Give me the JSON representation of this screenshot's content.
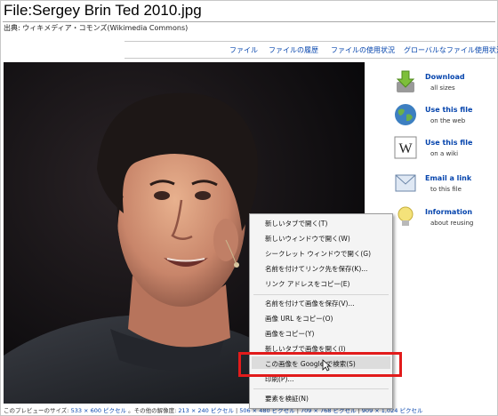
{
  "page": {
    "title": "File:Sergey Brin Ted 2010.jpg",
    "source": "出典: ウィキメディア・コモンズ(Wikimedia Commons)"
  },
  "tabs": [
    {
      "label": "ファイル"
    },
    {
      "label": "ファイルの履歴"
    },
    {
      "label": "ファイルの使用状況"
    },
    {
      "label": "グローバルなファイル使用状況"
    }
  ],
  "sidebar": {
    "items": [
      {
        "title": "Download",
        "sub": "all sizes",
        "icon": "download-icon"
      },
      {
        "title": "Use this file",
        "sub": "on the web",
        "icon": "globe-icon"
      },
      {
        "title": "Use this file",
        "sub": "on a wiki",
        "icon": "wikipedia-icon"
      },
      {
        "title": "Email a link",
        "sub": "to this file",
        "icon": "email-icon"
      },
      {
        "title": "Information",
        "sub": "about reusing",
        "icon": "lightbulb-icon"
      }
    ]
  },
  "context_menu": {
    "items": [
      {
        "label": "新しいタブで開く(T)"
      },
      {
        "label": "新しいウィンドウで開く(W)"
      },
      {
        "label": "シークレット ウィンドウで開く(G)"
      },
      {
        "label": "名前を付けてリンク先を保存(K)..."
      },
      {
        "label": "リンク アドレスをコピー(E)"
      },
      {
        "label": "名前を付けて画像を保存(V)..."
      },
      {
        "label": "画像 URL をコピー(O)"
      },
      {
        "label": "画像をコピー(Y)"
      },
      {
        "label": "新しいタブで画像を開く(I)"
      },
      {
        "label": "この画像を Google で検索(S)"
      },
      {
        "label": "印刷(P)..."
      },
      {
        "label": "要素を検証(N)"
      }
    ],
    "highlighted_index": 9
  },
  "caption": {
    "text": "このプレビューのサイズ:",
    "size_link": "533 × 600 ピクセル",
    "other_text": "。その他の解像度:",
    "res": [
      "213 × 240 ピクセル",
      "506 × 480 ピクセル",
      "709 × 768 ピクセル",
      "909 × 1,024 ピクセル"
    ]
  },
  "colors": {
    "link": "#0645ad",
    "highlight_box": "#e21b1b",
    "photo_background": "#0b0b0e"
  }
}
